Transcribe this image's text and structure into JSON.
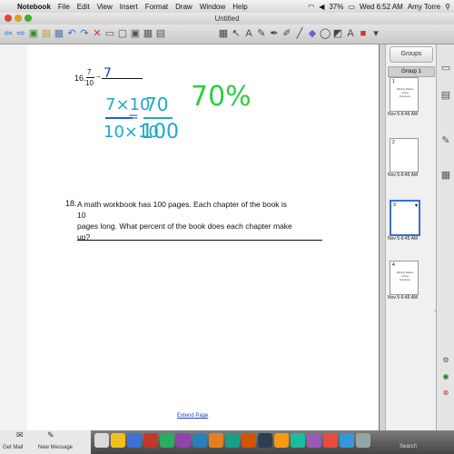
{
  "menubar": {
    "app_name": "Notebook",
    "items": [
      "File",
      "Edit",
      "View",
      "Insert",
      "Format",
      "Draw",
      "Window",
      "Help"
    ],
    "battery": "37%",
    "clock": "Wed 6:52 AM",
    "user": "Amy Torre"
  },
  "window": {
    "title": "Untitled"
  },
  "page": {
    "q16_number": "16.",
    "q16_numerator": "7",
    "q16_denominator": "10",
    "q16_answer": "7",
    "work_top": "7×10",
    "work_bottom": "10×10",
    "work_eq_num": "70",
    "work_eq_den": "100",
    "work_percent": "70%",
    "q18_number": "18.",
    "q18_line1": "A math workbook has 100 pages. Each chapter of the book is 10",
    "q18_line2": "pages long. What percent of the book does each chapter make up?",
    "extend_page": "Extend Page"
  },
  "sidebar": {
    "header": "Groups",
    "group_label": "Group 1",
    "thumbnails": [
      {
        "num": "1",
        "date": "Nov 5-6:46 AM",
        "text": "Writing Ratios Using Fractions",
        "selected": false
      },
      {
        "num": "2",
        "date": "Nov 5-6:45 AM",
        "text": "",
        "selected": false
      },
      {
        "num": "3",
        "date": "Nov 5-6:45 AM",
        "text": "",
        "selected": true
      },
      {
        "num": "4",
        "date": "Nov 5-6:45 AM",
        "text": "Writing Ratios Using Fractions",
        "selected": false
      }
    ]
  },
  "dock": {
    "get_mail": "Get Mail",
    "new_message": "New Message",
    "search": "Search"
  }
}
